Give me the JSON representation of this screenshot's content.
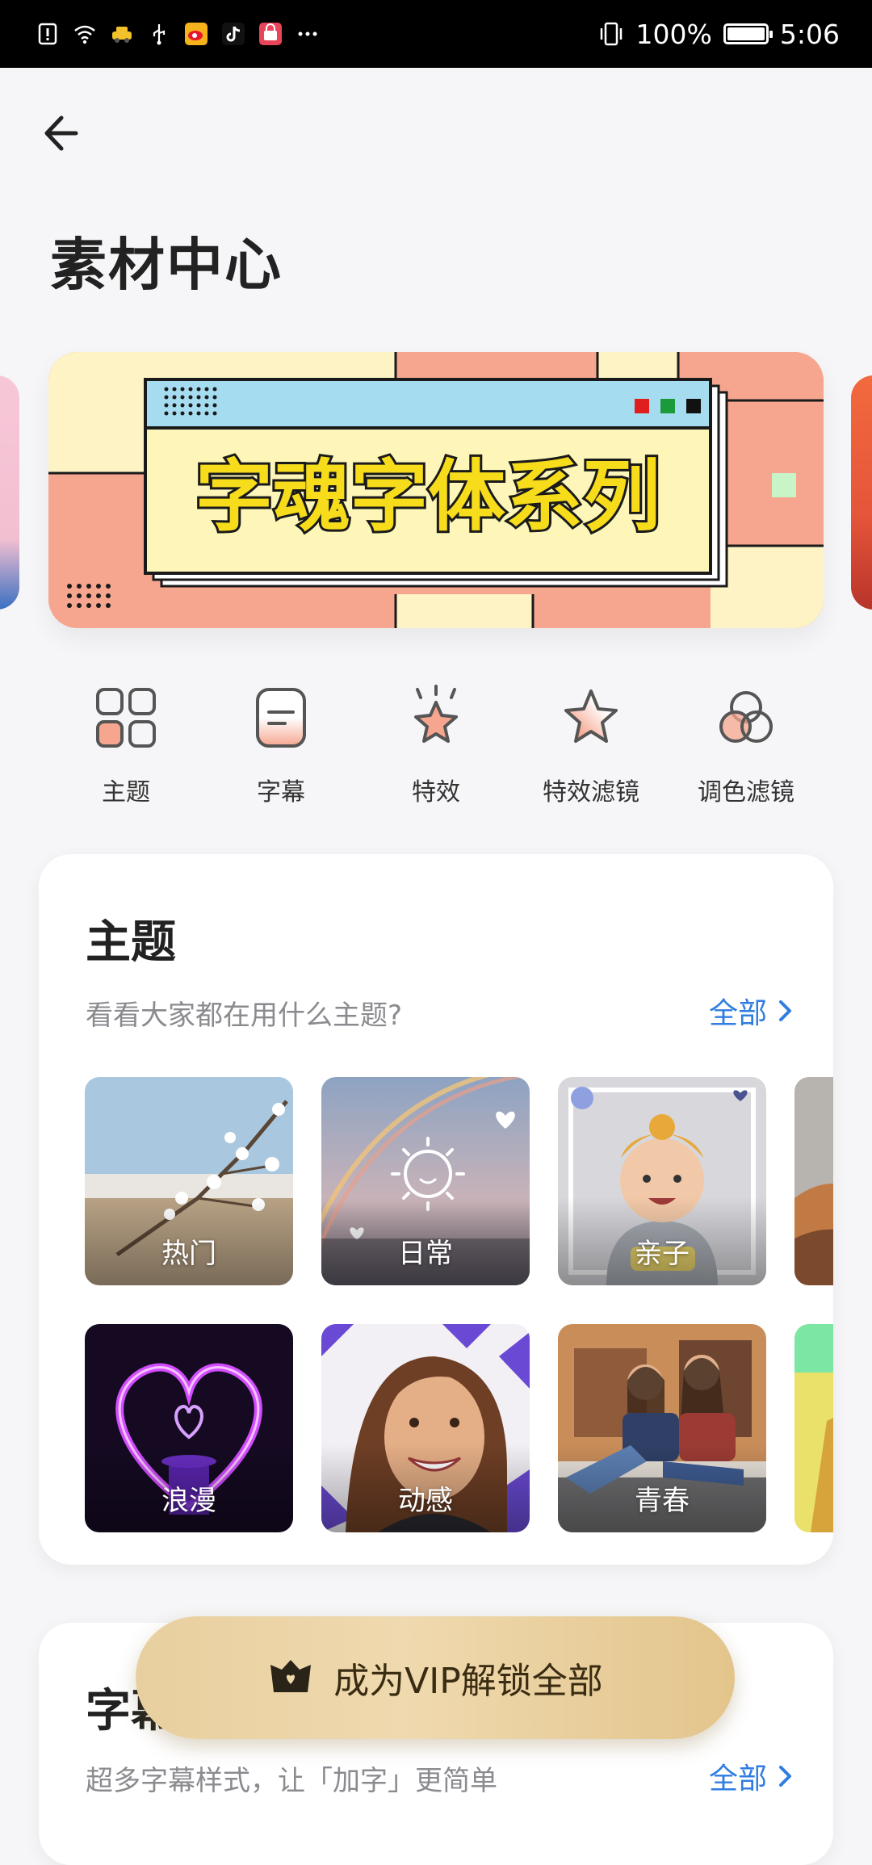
{
  "status_bar": {
    "battery_percent": "100%",
    "time": "5:06",
    "icons": [
      "alert-icon",
      "wifi-icon",
      "taxi-icon",
      "usb-icon",
      "weibo-icon",
      "tiktok-icon",
      "shop-icon",
      "more-dots-icon",
      "vibrate-icon",
      "battery-icon"
    ]
  },
  "header": {
    "back_icon": "back-arrow-icon",
    "title": "素材中心"
  },
  "banner": {
    "title": "字魂字体系列"
  },
  "categories": [
    {
      "label": "主题",
      "icon": "grid-icon"
    },
    {
      "label": "字幕",
      "icon": "subtitle-icon"
    },
    {
      "label": "特效",
      "icon": "sparkle-star-icon"
    },
    {
      "label": "特效滤镜",
      "icon": "star-filter-icon"
    },
    {
      "label": "调色滤镜",
      "icon": "color-circles-icon"
    }
  ],
  "theme_section": {
    "title": "主题",
    "description": "看看大家都在用什么主题?",
    "more_label": "全部",
    "tiles": [
      {
        "label": "热门"
      },
      {
        "label": "日常"
      },
      {
        "label": "亲子"
      },
      {
        "label": "浪漫"
      },
      {
        "label": "动感"
      },
      {
        "label": "青春"
      }
    ]
  },
  "subtitle_section": {
    "title": "字幕",
    "description": "超多字幕样式，让「加字」更简单",
    "more_label": "全部"
  },
  "vip_button": {
    "label": "成为VIP解锁全部",
    "icon": "crown-icon"
  },
  "colors": {
    "accent_blue": "#2f7de1",
    "vip_gold": "#e8cf9f",
    "icon_peach": "#f6a68f"
  }
}
